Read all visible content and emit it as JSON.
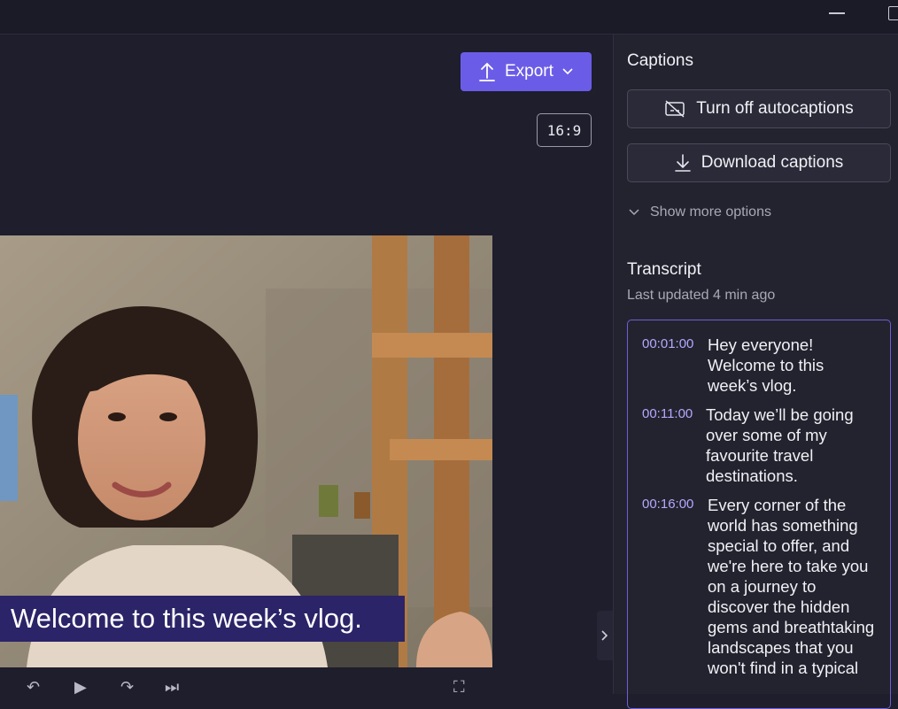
{
  "titlebar": {
    "minimize_icon": "minimize-icon",
    "maximize_icon": "maximize-icon"
  },
  "toolbar": {
    "export_label": "Export",
    "aspect_ratio": "16:9"
  },
  "video": {
    "caption_text": "Welcome to this week’s vlog."
  },
  "captions_panel": {
    "title": "Captions",
    "turn_off_label": "Turn off autocaptions",
    "download_label": "Download captions",
    "more_options_label": "Show more options"
  },
  "transcript": {
    "title": "Transcript",
    "updated": "Last updated 4 min ago",
    "entries": [
      {
        "time": "00:01:00",
        "text": "Hey everyone! Welcome to this week’s vlog."
      },
      {
        "time": "00:11:00",
        "text": "Today we’ll be going over some of my favourite travel destinations."
      },
      {
        "time": "00:16:00",
        "text": "Every corner of the world has something special to offer, and we're here to take you on a journey to discover the hidden gems and breathtaking landscapes that you won't find in a typical"
      }
    ]
  },
  "colors": {
    "accent": "#6b5ce7",
    "caption_bg": "#2b2468",
    "timestamp": "#b3a9ff"
  }
}
